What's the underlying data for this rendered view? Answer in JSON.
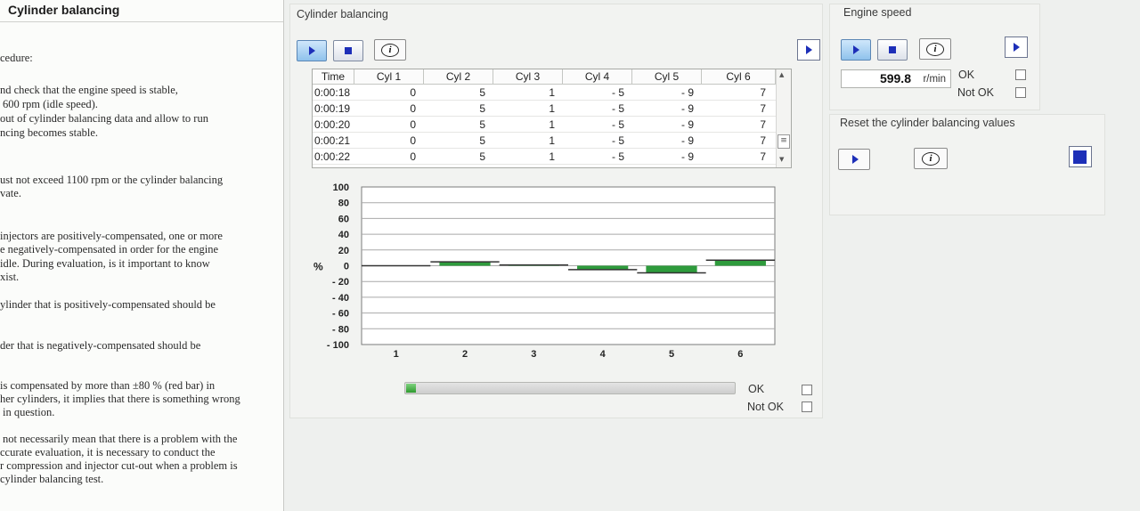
{
  "left": {
    "title": "Cylinder balancing",
    "lines": [
      "cedure:",
      "nd check that the engine speed is stable,",
      "600 rpm (idle speed).",
      "out of cylinder balancing data and allow to run",
      "ncing becomes stable.",
      "ust not exceed 1100 rpm or the cylinder balancing",
      "vate.",
      "injectors are positively-compensated, one or more",
      "e negatively-compensated in order for the engine",
      "idle. During evaluation, is it important to know",
      "xist.",
      "ylinder that is positively-compensated should be",
      "der that is negatively-compensated should be",
      "is compensated by more than ±80 % (red bar) in",
      "her cylinders, it implies that there is something wrong",
      "in question.",
      "not necessarily mean that there is a problem with the",
      "ccurate evaluation, it is necessary to conduct the",
      "r compression and injector cut-out when a problem is",
      "cylinder balancing test."
    ]
  },
  "main": {
    "title": "Cylinder balancing",
    "info_glyph": "i",
    "table": {
      "headers": [
        "Time",
        "Cyl 1",
        "Cyl 2",
        "Cyl 3",
        "Cyl 4",
        "Cyl 5",
        "Cyl 6"
      ],
      "rows": [
        [
          "0:00:18",
          "0",
          "5",
          "1",
          "- 5",
          "- 9",
          "7"
        ],
        [
          "0:00:19",
          "0",
          "5",
          "1",
          "- 5",
          "- 9",
          "7"
        ],
        [
          "0:00:20",
          "0",
          "5",
          "1",
          "- 5",
          "- 9",
          "7"
        ],
        [
          "0:00:21",
          "0",
          "5",
          "1",
          "- 5",
          "- 9",
          "7"
        ],
        [
          "0:00:22",
          "0",
          "5",
          "1",
          "- 5",
          "- 9",
          "7"
        ]
      ],
      "scroll_up_glyph": "▲",
      "scroll_down_glyph": "▼",
      "scroll_grip_glyph": "≡"
    },
    "chart_data": {
      "type": "bar",
      "categories": [
        "1",
        "2",
        "3",
        "4",
        "5",
        "6"
      ],
      "values": [
        0,
        5,
        1,
        -5,
        -9,
        7
      ],
      "ylim": [
        -100,
        100
      ],
      "yticks": [
        "100",
        "80",
        "60",
        "40",
        "20",
        "0",
        "- 20",
        "- 40",
        "- 60",
        "- 80",
        "- 100"
      ],
      "ylabel": "%",
      "bar_color": "#2e9b3c",
      "grid": true
    },
    "progress": 0.03,
    "ok_label": "OK",
    "not_ok_label": "Not OK"
  },
  "engine": {
    "title": "Engine speed",
    "info_glyph": "i",
    "value": "599.8",
    "unit": "r/min",
    "ok_label": "OK",
    "not_ok_label": "Not OK"
  },
  "reset": {
    "title": "Reset the cylinder balancing values",
    "info_glyph": "i"
  },
  "colors": {
    "accent": "#1d2fb8",
    "bar": "#2e9b3c",
    "progress": "#3ca63c"
  }
}
